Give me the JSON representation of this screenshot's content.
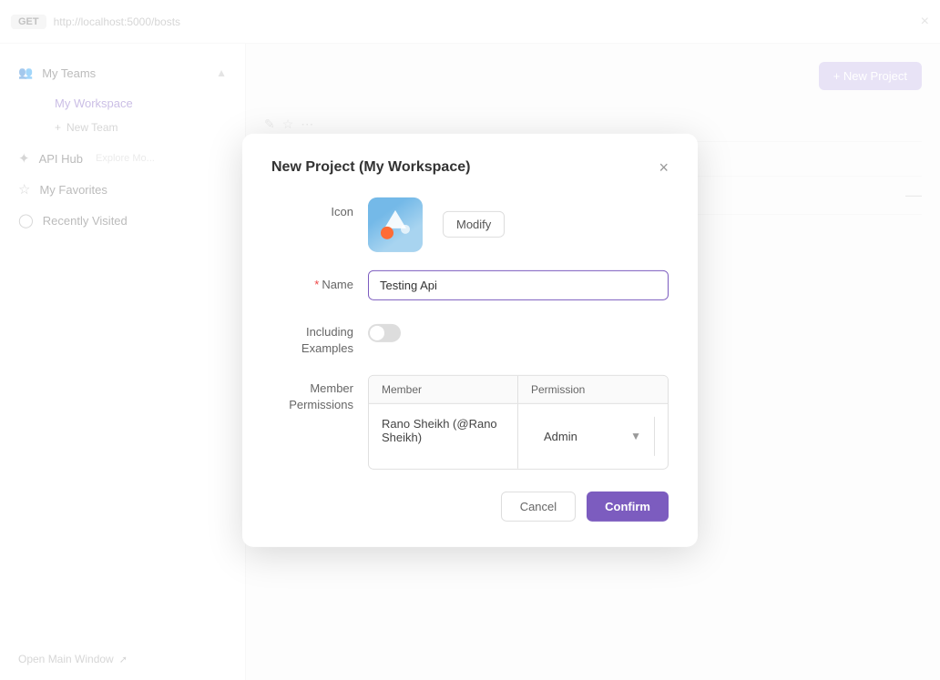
{
  "topbar": {
    "method": "GET",
    "url": "http://localhost:5000/bosts",
    "close_icon": "×"
  },
  "sidebar": {
    "my_teams_label": "My Teams",
    "my_workspace_label": "My Workspace",
    "new_team_label": "New Team",
    "api_hub_label": "API Hub",
    "api_hub_sub": "Explore Mo...",
    "my_favorites_label": "My Favorites",
    "recently_visited_label": "Recently Visited",
    "bottom_link": "Open Main Window"
  },
  "main": {
    "new_project_btn": "+ New Project"
  },
  "modal": {
    "title": "New Project (My Workspace)",
    "close_icon": "×",
    "icon_label": "Icon",
    "modify_label": "Modify",
    "name_label": "Name",
    "name_required": "*",
    "name_value": "Testing Api",
    "including_examples_label": "Including\nExamples",
    "member_permissions_label": "Member\nPermissions",
    "table_header_member": "Member",
    "table_header_permission": "Permission",
    "member_name": "Rano Sheikh (@Rano\nSheikh)",
    "permission_value": "Admin",
    "cancel_label": "Cancel",
    "confirm_label": "Confirm"
  }
}
